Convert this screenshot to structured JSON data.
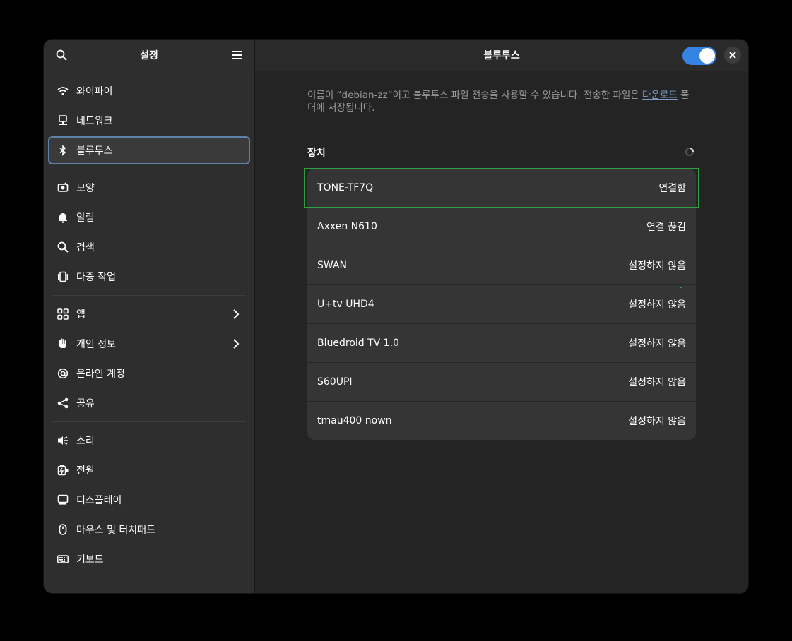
{
  "sidebar": {
    "title": "설정",
    "groups": [
      [
        {
          "label": "와이파이",
          "icon": "wifi-icon"
        },
        {
          "label": "네트워크",
          "icon": "network-icon"
        },
        {
          "label": "블루투스",
          "icon": "bluetooth-icon",
          "selected": true
        }
      ],
      [
        {
          "label": "모양",
          "icon": "appearance-icon"
        },
        {
          "label": "알림",
          "icon": "bell-icon"
        },
        {
          "label": "검색",
          "icon": "search-icon"
        },
        {
          "label": "다중 작업",
          "icon": "multitasking-icon"
        }
      ],
      [
        {
          "label": "앱",
          "icon": "apps-icon",
          "chevron": true
        },
        {
          "label": "개인 정보",
          "icon": "hand-icon",
          "chevron": true
        },
        {
          "label": "온라인 계정",
          "icon": "at-icon"
        },
        {
          "label": "공유",
          "icon": "share-icon"
        }
      ],
      [
        {
          "label": "소리",
          "icon": "speaker-icon"
        },
        {
          "label": "전원",
          "icon": "power-icon"
        },
        {
          "label": "디스플레이",
          "icon": "display-icon"
        },
        {
          "label": "마우스 및 터치패드",
          "icon": "mouse-icon"
        },
        {
          "label": "키보드",
          "icon": "keyboard-icon"
        }
      ]
    ]
  },
  "header": {
    "title": "블루투스",
    "bluetooth_enabled": true
  },
  "description": {
    "text": "이름이 “debian-zz”이고 블루투스 파일 전송을 사용할 수 있습니다. 전송한 파일은 ",
    "link": "다운로드",
    "suffix": " 폴더에 저장됩니다."
  },
  "devices_section": {
    "title": "장치",
    "items": [
      {
        "name": "TONE-TF7Q",
        "status": "연결함"
      },
      {
        "name": "Axxen N610",
        "status": "연결 끊김"
      },
      {
        "name": "SWAN",
        "status": "설정하지 않음"
      },
      {
        "name": "U+tv UHD4",
        "status": "설정하지 않음"
      },
      {
        "name": "Bluedroid TV 1.0",
        "status": "설정하지 않음"
      },
      {
        "name": "S60UPI",
        "status": "설정하지 않음"
      },
      {
        "name": "tmau400 nown",
        "status": "설정하지 않음"
      }
    ]
  },
  "colors": {
    "accent": "#3584e4",
    "focus": "#2ea043",
    "link": "#7c9cc8"
  }
}
